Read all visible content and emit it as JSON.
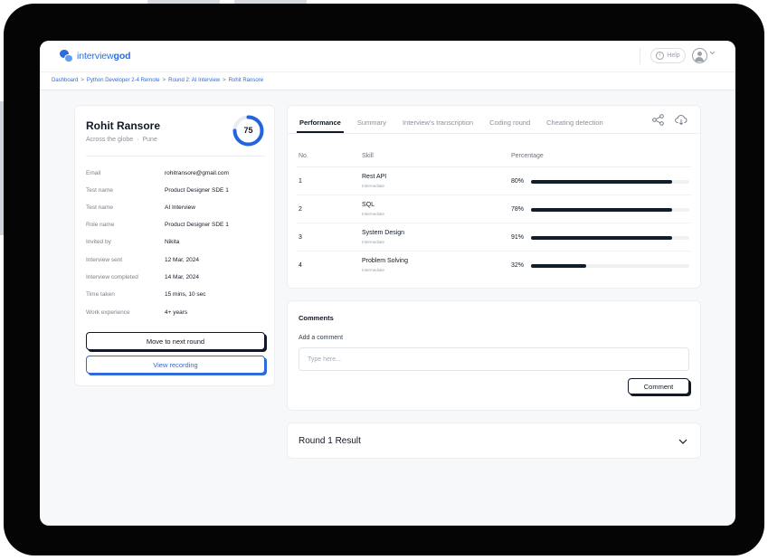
{
  "app": {
    "brand": {
      "prefix": "interview",
      "suffix": "god"
    },
    "help_label": "Help",
    "help_icon_glyph": "i"
  },
  "breadcrumb": [
    "Dashboard",
    "Python Developer 2-4 Remote",
    "Round 2: AI Interview",
    "Rohit Ransore"
  ],
  "candidate": {
    "name": "Rohit Ransore",
    "location_primary": "Across the globe",
    "location_secondary": "Pune",
    "score": "75",
    "score_fraction": 0.75,
    "fields": [
      {
        "label": "Email",
        "value": "rohitransore@gmail.com"
      },
      {
        "label": "Test name",
        "value": "Product Designer SDE 1"
      },
      {
        "label": "Test name",
        "value": "AI Interview"
      },
      {
        "label": "Role name",
        "value": "Product Designer SDE 1"
      },
      {
        "label": "Invited by",
        "value": "Nikita"
      },
      {
        "label": "Interview sent",
        "value": "12 Mar, 2024"
      },
      {
        "label": "Interview completed",
        "value": "14 Mar, 2024"
      },
      {
        "label": "Time taken",
        "value": "15 mins, 10 sec"
      },
      {
        "label": "Work experience",
        "value": "4+ years"
      }
    ],
    "actions": {
      "next_round": "Move to next round",
      "view_recording": "View recording"
    }
  },
  "tabs": [
    "Performance",
    "Summary",
    "Interview's transcription",
    "Coding round",
    "Cheating detection"
  ],
  "performance": {
    "headers": {
      "no": "No.",
      "skill": "Skill",
      "percentage": "Percentage"
    },
    "rows": [
      {
        "no": "1",
        "skill": "Rest API",
        "level": "Intermediate",
        "pct": "80%",
        "fill": 0.89
      },
      {
        "no": "2",
        "skill": "SQL",
        "level": "Intermediate",
        "pct": "78%",
        "fill": 0.89
      },
      {
        "no": "3",
        "skill": "System Design",
        "level": "Intermediate",
        "pct": "91%",
        "fill": 0.89
      },
      {
        "no": "4",
        "skill": "Problem Solving",
        "level": "Intermediate",
        "pct": "32%",
        "fill": 0.35
      }
    ]
  },
  "comments": {
    "title": "Comments",
    "label": "Add a comment",
    "placeholder": "Type here...",
    "value": "",
    "button": "Comment"
  },
  "round_result": {
    "title": "Round 1 Result"
  },
  "colors": {
    "brand": "#2f6bd8",
    "score_ring": "#2464e0",
    "bar": "#111c2d",
    "frame": "#050505"
  }
}
